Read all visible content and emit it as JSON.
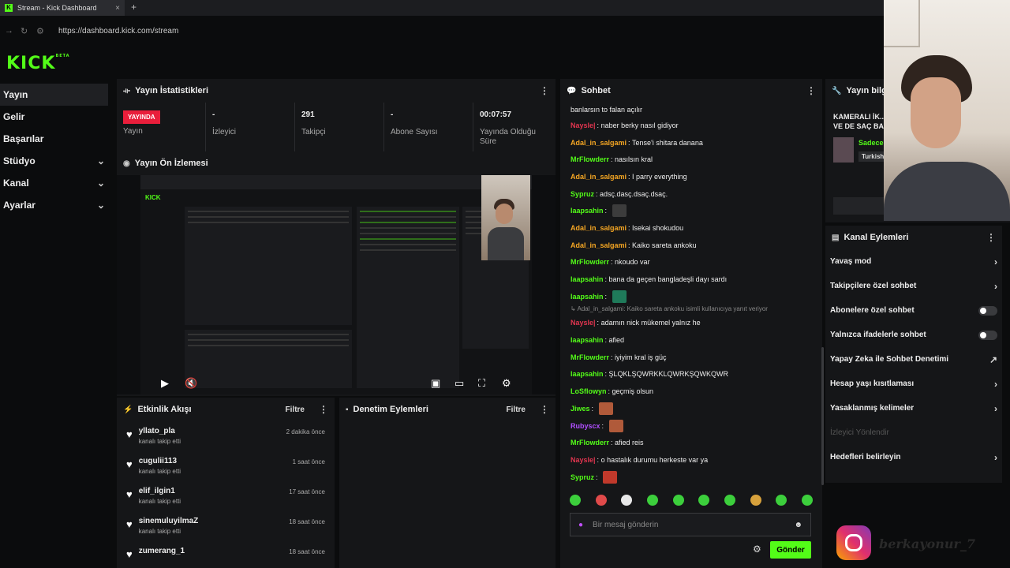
{
  "browser": {
    "tab_title": "Stream - Kick Dashboard",
    "tab_close": "×",
    "new_tab": "+",
    "url": "https://dashboard.kick.com/stream"
  },
  "logo": {
    "text": "KICK",
    "beta": "BETA"
  },
  "sidebar": {
    "items": [
      {
        "label": "Yayın",
        "chev": ""
      },
      {
        "label": "Gelir",
        "chev": ""
      },
      {
        "label": "Başarılar",
        "chev": ""
      },
      {
        "label": "Stüdyo",
        "chev": "⌄"
      },
      {
        "label": "Kanal",
        "chev": "⌄"
      },
      {
        "label": "Ayarlar",
        "chev": "⌄"
      }
    ]
  },
  "stats_panel": {
    "title": "Yayın İstatistikleri",
    "live_badge": "YAYINDA",
    "items": [
      {
        "value": "",
        "label": "Yayın"
      },
      {
        "value": "-",
        "label": "İzleyici"
      },
      {
        "value": "291",
        "label": "Takipçi"
      },
      {
        "value": "-",
        "label": "Abone Sayısı"
      },
      {
        "value": "00:07:57",
        "label": "Yayında Olduğu Süre"
      }
    ]
  },
  "preview_panel": {
    "title": "Yayın Ön İzlemesi"
  },
  "feed_panel": {
    "title": "Etkinlik Akışı",
    "filter": "Filtre",
    "items": [
      {
        "name": "yllato_pla",
        "sub": "kanalı takip etti",
        "time": "2 dakika önce"
      },
      {
        "name": "cugulii113",
        "sub": "kanalı takip etti",
        "time": "1 saat önce"
      },
      {
        "name": "elif_ilgin1",
        "sub": "kanalı takip etti",
        "time": "17 saat önce"
      },
      {
        "name": "sinemuluyilmaZ",
        "sub": "kanalı takip etti",
        "time": "18 saat önce"
      },
      {
        "name": "zumerang_1",
        "sub": "",
        "time": "18 saat önce"
      }
    ]
  },
  "moderation_panel": {
    "title": "Denetim Eylemleri",
    "filter": "Filtre"
  },
  "chat_panel": {
    "title": "Sohbet",
    "top_text": "banlarsın to falan açılır",
    "messages": [
      {
        "user": "Naysle|",
        "color": "#e0354f",
        "text": "naber berky nasıl gidiyor",
        "emote": ""
      },
      {
        "user": "Adal_in_salgami",
        "color": "#f5a623",
        "text": "Tense'i shitara danana",
        "emote": ""
      },
      {
        "user": "MrFlowderr",
        "color": "#53fc18",
        "text": "nasılsın kral",
        "emote": ""
      },
      {
        "user": "Adal_in_salgami",
        "color": "#f5a623",
        "text": "I parry everything",
        "emote": ""
      },
      {
        "user": "Sypruz",
        "color": "#53fc18",
        "text": "adsç.dasç.dsaç.dsaç.",
        "emote": ""
      },
      {
        "user": "laapsahin",
        "color": "#53fc18",
        "text": "",
        "emote": "#3c3c3c"
      },
      {
        "user": "Adal_in_salgami",
        "color": "#f5a623",
        "text": "Isekai shokudou",
        "emote": ""
      },
      {
        "user": "Adal_in_salgami",
        "color": "#f5a623",
        "text": "Kaiko sareta ankoku",
        "emote": ""
      },
      {
        "user": "MrFlowderr",
        "color": "#53fc18",
        "text": "nkoudo var",
        "emote": ""
      },
      {
        "user": "laapsahin",
        "color": "#53fc18",
        "text": "bana da geçen bangladeşli dayı sardı",
        "emote": ""
      },
      {
        "user": "laapsahin",
        "color": "#53fc18",
        "text": "",
        "emote": "#1f7a5a"
      }
    ],
    "reply_text": "↳ Adal_in_salgami: Kaiko sareta ankoku isimli kullanıcıya yanıt veriyor",
    "messages2": [
      {
        "user": "Naysle|",
        "color": "#e0354f",
        "text": "adamın nick mükemel yalnız he",
        "emote": ""
      },
      {
        "user": "laapsahin",
        "color": "#53fc18",
        "text": "afied",
        "emote": ""
      },
      {
        "user": "MrFlowderr",
        "color": "#53fc18",
        "text": "iyiyim kral iş güç",
        "emote": ""
      },
      {
        "user": "laapsahin",
        "color": "#53fc18",
        "text": "ŞLQKLŞQWRKKLQWRKŞQWKQWR",
        "emote": ""
      },
      {
        "user": "LoSflowyn",
        "color": "#53fc18",
        "text": "geçmiş olsun",
        "emote": ""
      },
      {
        "user": "Jiwes",
        "color": "#53fc18",
        "text": "",
        "emote": "#b05a3a"
      },
      {
        "user": "Rubyscx",
        "color": "#b04fff",
        "text": "",
        "emote": "#b05a3a"
      },
      {
        "user": "MrFlowderr",
        "color": "#53fc18",
        "text": "afied reis",
        "emote": ""
      },
      {
        "user": "Naysle|",
        "color": "#e0354f",
        "text": "o hastalık durumu herkeste var ya",
        "emote": ""
      },
      {
        "user": "Sypruz",
        "color": "#53fc18",
        "text": "",
        "emote": "#c0392b"
      }
    ],
    "emote_colors": [
      "#3ccf3c",
      "#e04a4a",
      "#e8e8e8",
      "#3ccf3c",
      "#3ccf3c",
      "#3ccf3c",
      "#3ccf3c",
      "#d7a13c",
      "#3ccf3c",
      "#3ccf3c"
    ],
    "input_placeholder": "Bir mesaj gönderin",
    "send_label": "Gönder"
  },
  "info_panel": {
    "title": "Yayın bilgisi",
    "stream_title": "KAMERALI İK... VE DE SAÇ BA...",
    "green_text": "Sadece",
    "tag": "Turkish"
  },
  "actions_panel": {
    "title": "Kanal Eylemleri",
    "items": [
      {
        "label": "Yavaş mod",
        "kind": "chevron"
      },
      {
        "label": "Takipçilere özel sohbet",
        "kind": "chevron"
      },
      {
        "label": "Abonelere özel sohbet",
        "kind": "toggle"
      },
      {
        "label": "Yalnızca ifadelerle sohbet",
        "kind": "toggle"
      },
      {
        "label": "Yapay Zeka ile Sohbet Denetimi",
        "kind": "external"
      },
      {
        "label": "Hesap yaşı kısıtlaması",
        "kind": "chevron"
      },
      {
        "label": "Yasaklanmış kelimeler",
        "kind": "chevron"
      },
      {
        "label": "İzleyici Yönlendir",
        "kind": "dim"
      },
      {
        "label": "Hedefleri belirleyin",
        "kind": "chevron"
      }
    ]
  },
  "overlay": {
    "handle": "berkayonur_7"
  },
  "colors": {
    "brand": "#53fc18",
    "live": "#e91e3b",
    "panel": "#151618"
  }
}
